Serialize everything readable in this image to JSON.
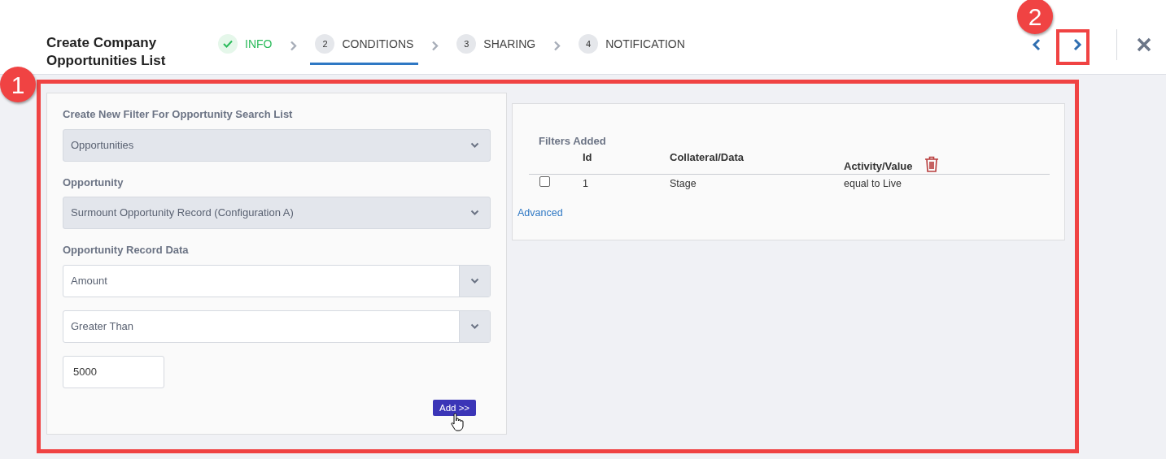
{
  "header": {
    "title": "Create Company Opportunities List"
  },
  "steps": [
    {
      "label": "INFO",
      "completed": true,
      "selected": false
    },
    {
      "number": "2",
      "label": "CONDITIONS",
      "completed": false,
      "selected": true
    },
    {
      "number": "3",
      "label": "SHARING",
      "completed": false,
      "selected": false
    },
    {
      "number": "4",
      "label": "NOTIFICATION",
      "completed": false,
      "selected": false
    }
  ],
  "filter_form": {
    "fields": [
      {
        "kind": "select",
        "label": "Create New Filter For Opportunity Search List",
        "value": "Opportunities",
        "disabled": true
      },
      {
        "kind": "select",
        "label": "Opportunity",
        "value": "Surmount Opportunity Record (Configuration A)",
        "disabled": true
      },
      {
        "kind": "select",
        "label": "Opportunity Record Data",
        "value": "Amount",
        "disabled": false
      },
      {
        "kind": "select",
        "value": "Greater Than",
        "disabled": false
      },
      {
        "kind": "input",
        "value": "5000"
      }
    ],
    "add_button": "Add >>"
  },
  "filters_added": {
    "title": "Filters Added",
    "columns": [
      "Id",
      "Collateral/Data",
      "Activity/Value"
    ],
    "rows": [
      {
        "checked": false,
        "cells": [
          "1",
          "Stage",
          "equal to Live"
        ]
      }
    ],
    "link": "Advanced"
  },
  "annotations": [
    {
      "label": "1"
    },
    {
      "label": "2"
    }
  ]
}
